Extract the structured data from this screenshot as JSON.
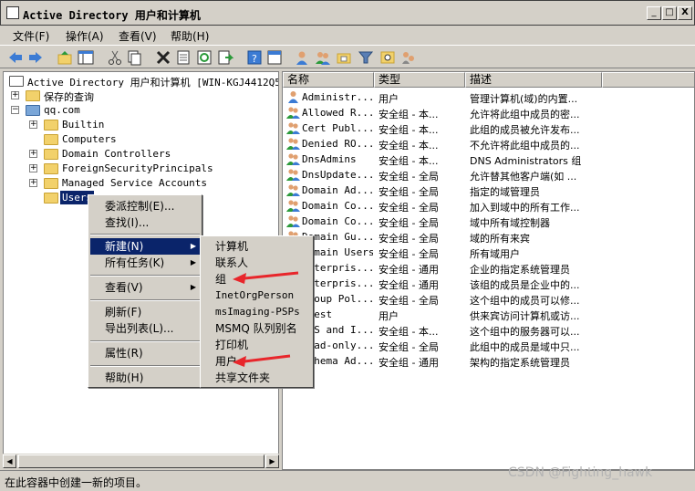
{
  "window": {
    "title": "Active Directory 用户和计算机",
    "controls": {
      "minimize": "_",
      "maximize": "□",
      "close": "X"
    }
  },
  "menu": [
    "文件(F)",
    "操作(A)",
    "查看(V)",
    "帮助(H)"
  ],
  "toolbar": [
    "back-icon",
    "forward-icon",
    "up-icon",
    "console-tree-icon",
    "cut-icon",
    "copy-icon",
    "delete-icon",
    "properties-icon",
    "refresh-icon",
    "export-icon",
    "help-icon",
    "show-icon",
    "new-user-icon",
    "new-group-icon",
    "new-ou-icon",
    "filter-icon",
    "find-icon",
    "add-to-group-icon"
  ],
  "tree": {
    "root": "Active Directory 用户和计算机 [WIN-KGJ4412Q5V1",
    "saved_queries": "保存的查询",
    "domain": "qq.com",
    "children": [
      "Builtin",
      "Computers",
      "Domain Controllers",
      "ForeignSecurityPrincipals",
      "Managed Service Accounts",
      "Users"
    ]
  },
  "list": {
    "headers": [
      "名称",
      "类型",
      "描述"
    ],
    "rows": [
      {
        "name": "Administr...",
        "type": "用户",
        "desc": "管理计算机(域)的内置...",
        "icon": "user-icon"
      },
      {
        "name": "Allowed R...",
        "type": "安全组 - 本...",
        "desc": "允许将此组中成员的密...",
        "icon": "group-icon"
      },
      {
        "name": "Cert Publ...",
        "type": "安全组 - 本...",
        "desc": "此组的成员被允许发布...",
        "icon": "group-icon"
      },
      {
        "name": "Denied RO...",
        "type": "安全组 - 本...",
        "desc": "不允许将此组中成员的...",
        "icon": "group-icon"
      },
      {
        "name": "DnsAdmins",
        "type": "安全组 - 本...",
        "desc": "DNS Administrators 组",
        "icon": "group-icon"
      },
      {
        "name": "DnsUpdate...",
        "type": "安全组 - 全局",
        "desc": "允许替其他客户端(如 ...",
        "icon": "group-icon"
      },
      {
        "name": "Domain Ad...",
        "type": "安全组 - 全局",
        "desc": "指定的域管理员",
        "icon": "group-icon"
      },
      {
        "name": "Domain Co...",
        "type": "安全组 - 全局",
        "desc": "加入到域中的所有工作...",
        "icon": "group-icon"
      },
      {
        "name": "Domain Co...",
        "type": "安全组 - 全局",
        "desc": "域中所有域控制器",
        "icon": "group-icon"
      },
      {
        "name": "Domain Gu...",
        "type": "安全组 - 全局",
        "desc": "域的所有来宾",
        "icon": "group-icon"
      },
      {
        "name": "Domain Users",
        "type": "安全组 - 全局",
        "desc": "所有域用户",
        "icon": "group-icon"
      },
      {
        "name": "Enterpris...",
        "type": "安全组 - 通用",
        "desc": "企业的指定系统管理员",
        "icon": "group-icon"
      },
      {
        "name": "Enterpris...",
        "type": "安全组 - 通用",
        "desc": "该组的成员是企业中的...",
        "icon": "group-icon"
      },
      {
        "name": "Group Pol...",
        "type": "安全组 - 全局",
        "desc": "这个组中的成员可以修...",
        "icon": "group-icon"
      },
      {
        "name": "Guest",
        "type": "用户",
        "desc": "供来宾访问计算机或访...",
        "icon": "user-icon"
      },
      {
        "name": "RAS and I...",
        "type": "安全组 - 本...",
        "desc": "这个组中的服务器可以...",
        "icon": "group-icon"
      },
      {
        "name": "Read-only...",
        "type": "安全组 - 全局",
        "desc": "此组中的成员是域中只...",
        "icon": "group-icon"
      },
      {
        "name": "Schema Ad...",
        "type": "安全组 - 通用",
        "desc": "架构的指定系统管理员",
        "icon": "group-icon"
      }
    ]
  },
  "context_menu": {
    "items": [
      "委派控制(E)...",
      "查找(I)...",
      "新建(N)",
      "所有任务(K)",
      "查看(V)",
      "刷新(F)",
      "导出列表(L)...",
      "属性(R)",
      "帮助(H)"
    ]
  },
  "submenu": {
    "items": [
      "计算机",
      "联系人",
      "组",
      "InetOrgPerson",
      "msImaging-PSPs",
      "MSMQ 队列别名",
      "打印机",
      "用户",
      "共享文件夹"
    ]
  },
  "status": "在此容器中创建一新的项目。",
  "watermark": "CSDN @Fighting_hawk",
  "colors": {
    "selection": "#0a246a",
    "annotation_arrow": "#e8262b",
    "folder": "#f2d16b"
  }
}
